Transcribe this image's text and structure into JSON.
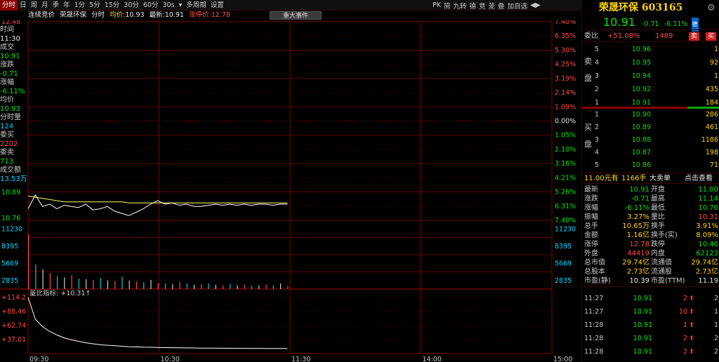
{
  "toolbar": {
    "tabs": [
      "分时",
      "日",
      "周",
      "月",
      "季",
      "年",
      "1分",
      "5分",
      "15分",
      "30分",
      "60分",
      "30s",
      "▾",
      "多周期",
      "设置"
    ],
    "right_items": [
      "PK",
      "简",
      "九转",
      "德",
      "竞",
      "茏",
      "叠",
      "加自选",
      "◀▶"
    ]
  },
  "info": {
    "section": "连续竞价",
    "stock_name": "荣晟环保",
    "mode": "分时",
    "avg_label": "均价:",
    "avg_value": "10.93",
    "latest_label": "最新:",
    "latest_value": "10.91",
    "limit_label": "涨停价:",
    "limit_value": "12.78",
    "event_button": "重大事件"
  },
  "left_panel": {
    "items": [
      {
        "label": "时间",
        "value": "11:30",
        "value_color": "white"
      },
      {
        "label": "成交",
        "value": "10.91",
        "value_color": "green"
      },
      {
        "label": "涨跌",
        "value": "-0.71",
        "value_color": "green"
      },
      {
        "label": "涨幅",
        "value": "-6.11%",
        "value_color": "green"
      },
      {
        "label": "均价",
        "value": "10.93",
        "value_color": "green"
      },
      {
        "label": "分时量",
        "value": "124",
        "value_color": "cyan"
      },
      {
        "label": "委买",
        "value": "2202",
        "value_color": "red"
      },
      {
        "label": "委卖",
        "value": "713",
        "value_color": "green"
      },
      {
        "label": "成交额",
        "value": "13.53万",
        "value_color": "cyan"
      }
    ]
  },
  "chart_data": {
    "type": "line",
    "price_axis_left": [
      "12.48",
      "10.89",
      "10.76"
    ],
    "pct_axis_right": [
      "7.40%",
      "6.35%",
      "5.30%",
      "4.25%",
      "3.19%",
      "2.14%",
      "1.09%",
      "0.00%",
      "1.05%",
      "2.10%",
      "3.16%",
      "4.21%",
      "5.26%",
      "6.31%",
      "7.40%"
    ],
    "pct_axis_colors": [
      "red",
      "red",
      "red",
      "red",
      "red",
      "red",
      "red",
      "white",
      "green",
      "green",
      "green",
      "green",
      "green",
      "green",
      "green"
    ],
    "volume_axis": [
      "11230",
      "8395",
      "5669",
      "2835"
    ],
    "ratio_title": "量比指标: +10.31↑",
    "ratio_axis": [
      "+114.2",
      "+88.46",
      "+62.74",
      "+37.01"
    ],
    "time_axis": [
      "09:30",
      "10:30",
      "11:30",
      "14:00",
      "15:00"
    ],
    "series": [
      {
        "values": [
          10.86,
          10.98,
          10.88,
          10.9,
          10.86,
          10.89,
          10.88,
          10.87,
          10.9,
          10.85,
          10.86,
          10.88,
          10.84,
          10.82,
          10.8,
          10.83,
          10.86,
          10.9,
          10.93,
          10.9,
          10.91,
          10.89,
          10.9,
          10.88,
          10.88,
          10.89,
          10.9,
          10.89,
          10.9,
          10.89,
          10.9,
          10.89,
          10.9,
          10.9,
          10.89,
          10.9,
          10.9
        ]
      },
      {
        "values": [
          10.97,
          10.96,
          10.95,
          10.94,
          10.93,
          10.92,
          10.92,
          10.92,
          10.92,
          10.92,
          10.92,
          10.92,
          10.92,
          10.92,
          10.91,
          10.91,
          10.91,
          10.91,
          10.91,
          10.91,
          10.91,
          10.91,
          10.91,
          10.91,
          10.91,
          10.91,
          10.91,
          10.91,
          10.91,
          10.91,
          10.91,
          10.91,
          10.91,
          10.91,
          10.91,
          10.91,
          10.91
        ]
      }
    ],
    "volume": [
      9000,
      4000,
      3200,
      2600,
      2100,
      1900,
      2300,
      1700,
      1600,
      1500,
      1800,
      1400,
      1300,
      2000,
      1400,
      1200,
      1100,
      1500,
      1000,
      900,
      800,
      1200,
      900,
      700,
      800,
      900,
      700,
      600,
      800,
      600,
      700,
      500,
      600,
      700,
      600,
      900,
      500
    ],
    "ratio": [
      114.2,
      70,
      55,
      45,
      38,
      32,
      28,
      25,
      22,
      20,
      18,
      17,
      16,
      15,
      14,
      13.5,
      13,
      12.8,
      12.5,
      12.2,
      12,
      11.8,
      11.6,
      11.4,
      11.2,
      11.1,
      11,
      10.9,
      10.8,
      10.7,
      10.6,
      10.55,
      10.5,
      10.45,
      10.4,
      10.35,
      10.31
    ]
  },
  "right_panel": {
    "title": "荣晟环保 603165",
    "price": "10.91",
    "change": "-0.71",
    "change_pct": "-6.11%",
    "badge": "德",
    "ratio_label": "委比",
    "ratio_value": "+51.08%",
    "ratio_diff": "1489",
    "sell_btn": "卖",
    "buy_btn": "买",
    "sell_side_label": "卖盘",
    "buy_side_label": "买盘",
    "sell": [
      {
        "level": "5",
        "price": "10.96",
        "vol": "1"
      },
      {
        "level": "4",
        "price": "10.95",
        "vol": "92"
      },
      {
        "level": "3",
        "price": "10.94",
        "vol": "1"
      },
      {
        "level": "2",
        "price": "10.92",
        "vol": "435"
      },
      {
        "level": "1",
        "price": "10.91",
        "vol": "184"
      }
    ],
    "buy": [
      {
        "level": "1",
        "price": "10.90",
        "vol": "286"
      },
      {
        "level": "2",
        "price": "10.89",
        "vol": "461"
      },
      {
        "level": "3",
        "price": "10.88",
        "vol": "1186"
      },
      {
        "level": "4",
        "price": "10.87",
        "vol": "198"
      },
      {
        "level": "5",
        "price": "10.86",
        "vol": "71"
      }
    ],
    "big_order": {
      "price": "11.00元有",
      "qty": "1166手",
      "label": "大卖单",
      "link": "点击查看"
    },
    "stats": [
      {
        "l1": "最新",
        "v1": "10.91",
        "c1": "green",
        "l2": "开盘",
        "v2": "11.00",
        "c2": "green"
      },
      {
        "l1": "涨跌",
        "v1": "-0.71",
        "c1": "green",
        "l2": "最高",
        "v2": "11.14",
        "c2": "green"
      },
      {
        "l1": "涨幅",
        "v1": "-6.11%",
        "c1": "green",
        "l2": "最低",
        "v2": "10.76",
        "c2": "green"
      },
      {
        "l1": "振幅",
        "v1": "3.27%",
        "c1": "yellow",
        "l2": "量比",
        "v2": "10.31",
        "c2": "red"
      },
      {
        "l1": "总手",
        "v1": "10.65万",
        "c1": "yellow",
        "l2": "换手",
        "v2": "3.91%",
        "c2": "yellow"
      },
      {
        "l1": "金额",
        "v1": "1.16亿",
        "c1": "yellow",
        "l2": "换手(实)",
        "v2": "8.09%",
        "c2": "yellow"
      },
      {
        "l1": "涨停",
        "v1": "12.78",
        "c1": "red",
        "l2": "跌停",
        "v2": "10.46",
        "c2": "green"
      },
      {
        "l1": "外盘",
        "v1": "44419",
        "c1": "red",
        "l2": "内盘",
        "v2": "62123",
        "c2": "green"
      },
      {
        "l1": "总市值",
        "v1": "29.74亿",
        "c1": "yellow",
        "l2": "流通值",
        "v2": "29.74亿",
        "c2": "yellow"
      },
      {
        "l1": "总股本",
        "v1": "2.73亿",
        "c1": "yellow",
        "l2": "流通股",
        "v2": "2.73亿",
        "c2": "yellow"
      },
      {
        "l1": "市盈(静)",
        "v1": "10.39",
        "c1": "white",
        "l2": "市盈(TTM)",
        "v2": "11.19",
        "c2": "white"
      }
    ],
    "trades": [
      {
        "time": "11:27",
        "price": "10.91",
        "vol": "2",
        "n": "2"
      },
      {
        "time": "11:27",
        "price": "10.91",
        "vol": "10",
        "n": "1"
      },
      {
        "time": "11:28",
        "price": "10.91",
        "vol": "1",
        "n": "1"
      },
      {
        "time": "11:28",
        "price": "10.91",
        "vol": "2",
        "n": "2"
      },
      {
        "time": "11:28",
        "price": "10.91",
        "vol": "2",
        "n": "2"
      }
    ]
  }
}
